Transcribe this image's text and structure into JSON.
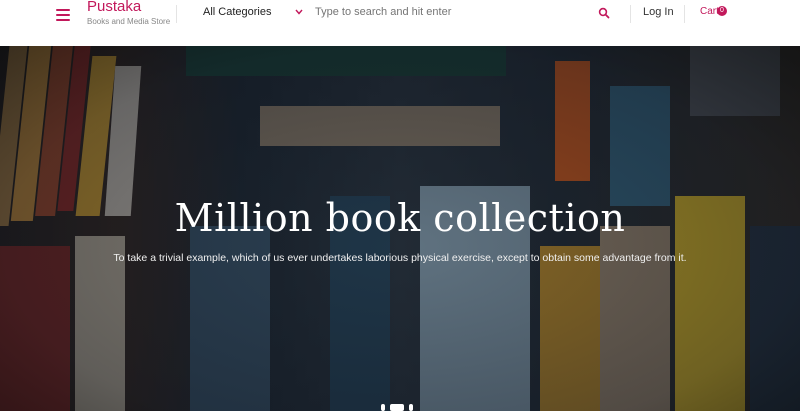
{
  "header": {
    "brand_title": "Pustaka",
    "brand_subtitle": "Books and Media Store",
    "category_label": "All Categories",
    "search_placeholder": "Type to search and hit enter",
    "login_label": "Log In",
    "cart_label": "Cart",
    "cart_count": "0"
  },
  "hero": {
    "title": "Million book collection",
    "subtitle": "To take a trivial example, which of us ever undertakes laborious physical exercise, except to obtain some advantage from it."
  },
  "colors": {
    "accent": "#c2185b",
    "hero_bg": "#2a333d"
  }
}
